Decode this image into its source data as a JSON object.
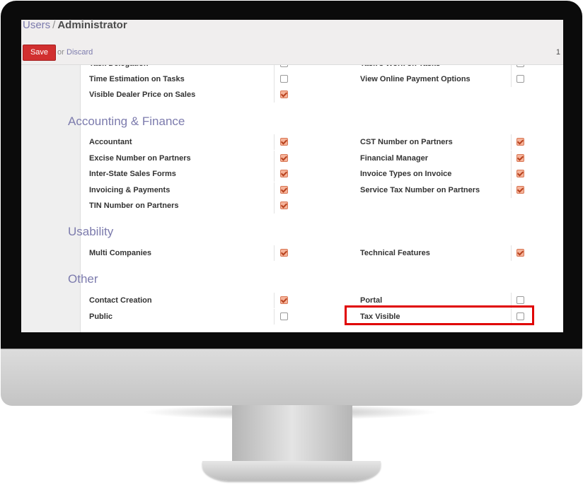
{
  "breadcrumb": {
    "parent": "Users",
    "separator": "/",
    "current": "Administrator"
  },
  "buttons": {
    "save": "Save",
    "or": "or",
    "discard": "Discard"
  },
  "pager": {
    "value": "1"
  },
  "top_rows": [
    {
      "left": "Task Delegation",
      "left_checked": false,
      "right": "Task's Work on Tasks",
      "right_checked": false
    },
    {
      "left": "Time Estimation on Tasks",
      "left_checked": false,
      "right": "View Online Payment Options",
      "right_checked": false
    },
    {
      "left": "Visible Dealer Price on Sales",
      "left_checked": true,
      "right": "",
      "right_checked": null
    }
  ],
  "sections": [
    {
      "title": "Accounting & Finance",
      "rows": [
        {
          "left": "Accountant",
          "left_checked": true,
          "right": "CST Number on Partners",
          "right_checked": true
        },
        {
          "left": "Excise Number on Partners",
          "left_checked": true,
          "right": "Financial Manager",
          "right_checked": true
        },
        {
          "left": "Inter-State Sales Forms",
          "left_checked": true,
          "right": "Invoice Types on Invoice",
          "right_checked": true
        },
        {
          "left": "Invoicing & Payments",
          "left_checked": true,
          "right": "Service Tax Number on Partners",
          "right_checked": true
        },
        {
          "left": "TIN Number on Partners",
          "left_checked": true,
          "right": "",
          "right_checked": null
        }
      ]
    },
    {
      "title": "Usability",
      "rows": [
        {
          "left": "Multi Companies",
          "left_checked": true,
          "right": "Technical Features",
          "right_checked": true
        }
      ]
    },
    {
      "title": "Other",
      "rows": [
        {
          "left": "Contact Creation",
          "left_checked": true,
          "right": "Portal",
          "right_checked": false
        },
        {
          "left": "Public",
          "left_checked": false,
          "right": "Tax Visible",
          "right_checked": false
        }
      ]
    }
  ],
  "colors": {
    "accent": "#7c7bad",
    "save": "#d12f2f",
    "highlight": "#e00000",
    "check_fill": "#f5b39a"
  }
}
